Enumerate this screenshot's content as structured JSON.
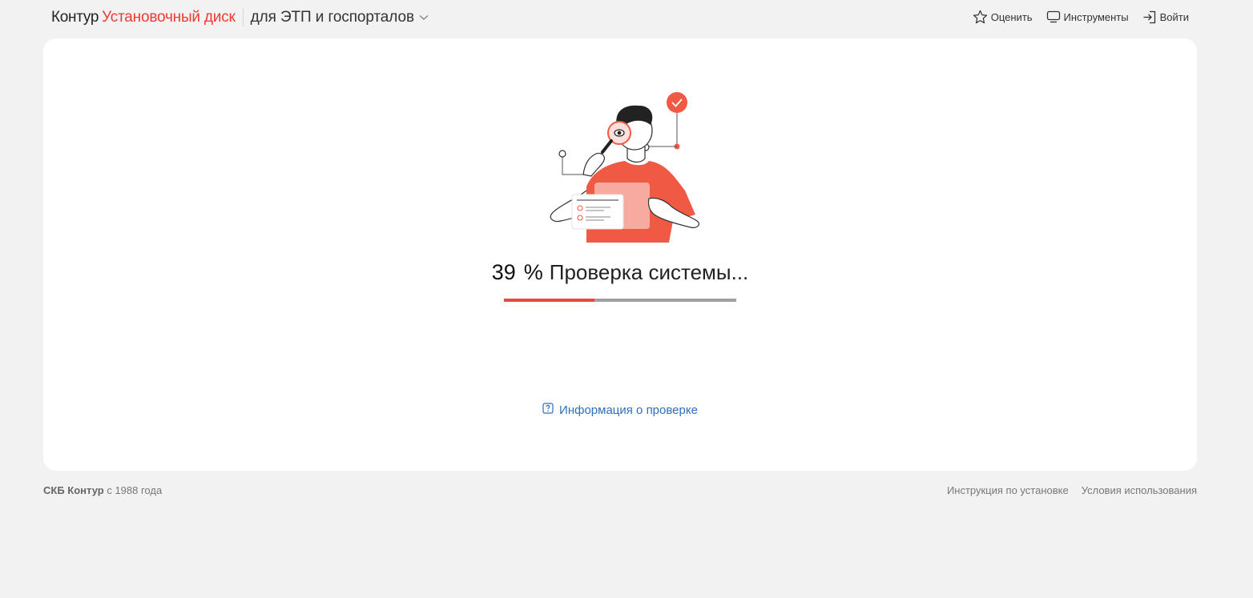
{
  "header": {
    "brand_name": "Контур",
    "product_name": "Установочный диск",
    "variant": "для ЭТП и госпорталов",
    "nav": {
      "rate_label": "Оценить",
      "tools_label": "Инструменты",
      "login_label": "Войти"
    }
  },
  "main": {
    "progress_percent": 39,
    "percent_number": "39",
    "percent_sign": "%",
    "status_text": "Проверка системы...",
    "info_link": "Информация о проверке"
  },
  "footer": {
    "company": "СКБ Контур",
    "since": "с 1988 года",
    "links": [
      "Инструкция по установке",
      "Условия использования"
    ]
  },
  "colors": {
    "accent": "#ee3b2f",
    "progress_fill": "#e9483b",
    "progress_track": "#a0a0a0",
    "link": "#2f6fbf",
    "page_bg": "#f2f2f2",
    "card_bg": "#ffffff"
  },
  "icons": {
    "chevron": "chevron-down-icon",
    "rate": "star-icon",
    "tools": "monitor-icon",
    "login": "login-icon",
    "info": "question-icon",
    "illustration": "person-with-magnifier-illustration"
  }
}
